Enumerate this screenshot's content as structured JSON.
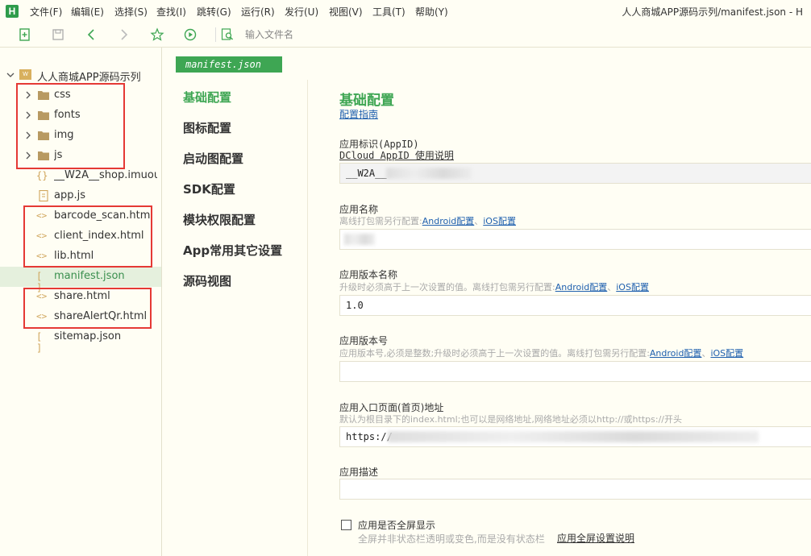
{
  "app": {
    "logo": "H",
    "window_title": "人人商城APP源码示列/manifest.json - H"
  },
  "menu": [
    "文件(F)",
    "编辑(E)",
    "选择(S)",
    "查找(I)",
    "跳转(G)",
    "运行(R)",
    "发行(U)",
    "视图(V)",
    "工具(T)",
    "帮助(Y)"
  ],
  "toolbar": {
    "icons": [
      "new-file-icon",
      "save-icon",
      "back-icon",
      "forward-icon",
      "star-icon",
      "run-icon",
      "search-file-icon"
    ],
    "search_placeholder": "输入文件名"
  },
  "project": {
    "name": "人人商城APP源码示列",
    "items": [
      {
        "label": "css",
        "type": "folder"
      },
      {
        "label": "fonts",
        "type": "folder"
      },
      {
        "label": "img",
        "type": "folder"
      },
      {
        "label": "js",
        "type": "folder"
      },
      {
        "label": "__W2A__shop.imuou...",
        "type": "brace"
      },
      {
        "label": "app.js",
        "type": "js"
      },
      {
        "label": "barcode_scan.html",
        "type": "html"
      },
      {
        "label": "client_index.html",
        "type": "html"
      },
      {
        "label": "lib.html",
        "type": "html"
      },
      {
        "label": "manifest.json",
        "type": "json",
        "selected": true
      },
      {
        "label": "share.html",
        "type": "html"
      },
      {
        "label": "shareAlertQr.html",
        "type": "html"
      },
      {
        "label": "sitemap.json",
        "type": "json"
      }
    ]
  },
  "editor": {
    "tab": "manifest.json",
    "nav": [
      "基础配置",
      "图标配置",
      "启动图配置",
      "SDK配置",
      "模块权限配置",
      "App常用其它设置",
      "源码视图"
    ],
    "section_title": "基础配置",
    "guide_link": "配置指南",
    "fields": {
      "appid": {
        "label": "应用标识(AppID)",
        "link": "DCloud AppID 使用说明",
        "value": "__W2A__"
      },
      "name": {
        "label": "应用名称",
        "hint": "离线打包需另行配置:",
        "value": ""
      },
      "version_name": {
        "label": "应用版本名称",
        "hint": "升级时必须高于上一次设置的值。离线打包需另行配置:",
        "value": "1.0"
      },
      "version_code": {
        "label": "应用版本号",
        "hint": "应用版本号,必须是整数;升级时必须高于上一次设置的值。离线打包需另行配置:",
        "value": ""
      },
      "entry": {
        "label": "应用入口页面(首页)地址",
        "hint": "默认为根目录下的index.html;也可以是网络地址,网络地址必须以http://或https://开头",
        "value": "https://"
      },
      "desc": {
        "label": "应用描述",
        "value": ""
      }
    },
    "android_link": "Android配置",
    "sep": "、",
    "ios_link": "iOS配置",
    "fullscreen": {
      "label": "应用是否全屏显示",
      "hint": "全屏并非状态栏透明或变色,而是没有状态栏",
      "link": "应用全屏设置说明"
    }
  },
  "colors": {
    "accent": "#3ea653",
    "link": "#1e5fae",
    "highlight_box": "#e53935",
    "selected_row": "#e5f0dd"
  }
}
